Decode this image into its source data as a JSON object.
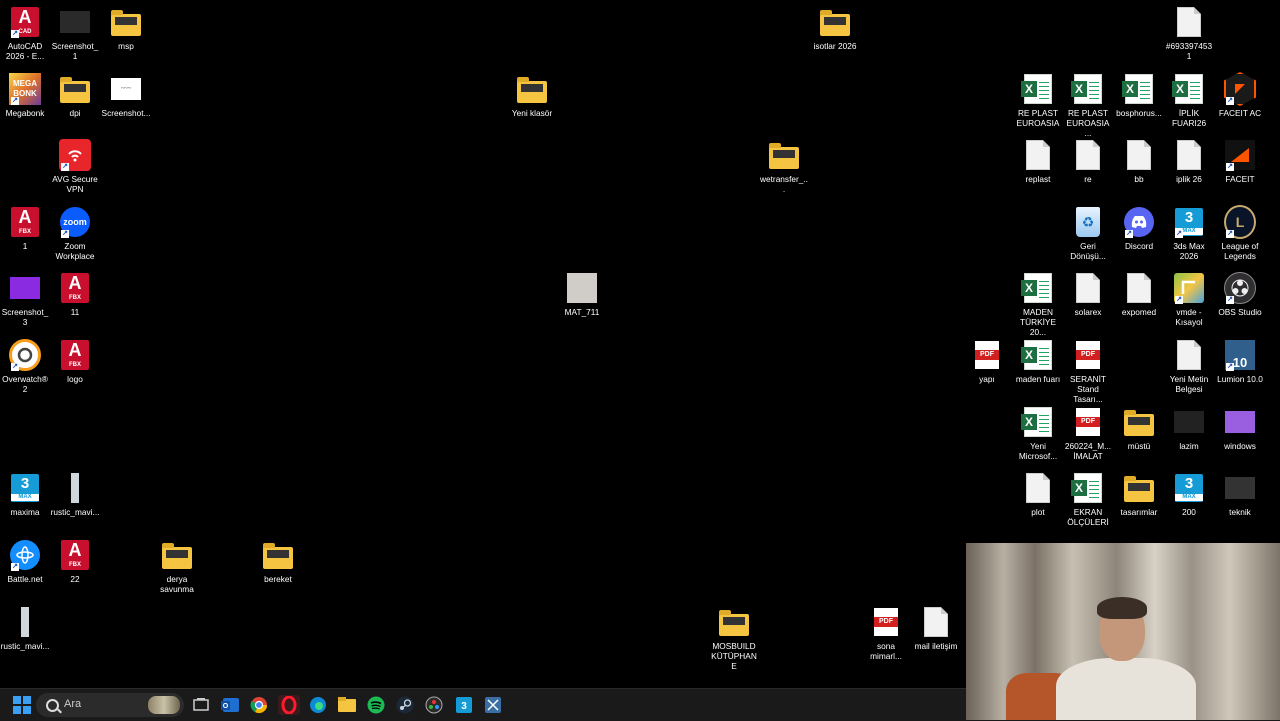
{
  "desktop": {
    "icons": [
      {
        "label": "AutoCAD 2026 - E...",
        "type": "acad",
        "sub": "CAD",
        "shortcut": true
      },
      {
        "label": "Screenshot_1",
        "type": "thumb",
        "color": "#2a2a2a"
      },
      {
        "label": "msp",
        "type": "folder"
      },
      {
        "label": "Megabonk",
        "type": "megabonk",
        "shortcut": true
      },
      {
        "label": "dpi",
        "type": "folder"
      },
      {
        "label": "Screenshot...",
        "type": "thumb-white"
      },
      {
        "label": "AVG Secure VPN",
        "type": "avg",
        "shortcut": true
      },
      {
        "label": "1",
        "type": "acad",
        "sub": "FBX"
      },
      {
        "label": "Zoom Workplace",
        "type": "zoom",
        "shortcut": true
      },
      {
        "label": "Screenshot_3",
        "type": "thumb",
        "color": "#8a2be2"
      },
      {
        "label": "11",
        "type": "acad",
        "sub": "FBX"
      },
      {
        "label": "Overwatch® 2",
        "type": "overwatch",
        "shortcut": true
      },
      {
        "label": "logo",
        "type": "acad",
        "sub": "FBX"
      },
      {
        "label": "maxima",
        "type": "max",
        "sub": "MAX"
      },
      {
        "label": "rustic_mavi...",
        "type": "thin"
      },
      {
        "label": "Battle.net",
        "type": "battlenet",
        "shortcut": true
      },
      {
        "label": "22",
        "type": "acad",
        "sub": "FBX"
      },
      {
        "label": "derya savunma",
        "type": "folder"
      },
      {
        "label": "bereket",
        "type": "folder"
      },
      {
        "label": "rustic_mavi...",
        "type": "thin"
      },
      {
        "label": "Yeni klasör",
        "type": "folder"
      },
      {
        "label": "MAT_711",
        "type": "gray"
      },
      {
        "label": "wetransfer_...",
        "type": "folder"
      },
      {
        "label": "isotlar 2026",
        "type": "folder"
      },
      {
        "label": "MOSBUILD KÜTÜPHANE",
        "type": "folder"
      },
      {
        "label": "sona mimarl...",
        "type": "pdf"
      },
      {
        "label": "mail iletişim",
        "type": "doc"
      },
      {
        "label": "#6933974531",
        "type": "doc"
      },
      {
        "label": "RE PLAST EUROASIA",
        "type": "excel"
      },
      {
        "label": "RE PLAST EUROASIA ...",
        "type": "excel"
      },
      {
        "label": "bosphorus...",
        "type": "excel"
      },
      {
        "label": "İPLİK FUARI26",
        "type": "excel"
      },
      {
        "label": "FACEIT AC",
        "type": "faceitac",
        "shortcut": true
      },
      {
        "label": "replast",
        "type": "doc"
      },
      {
        "label": "re",
        "type": "doc"
      },
      {
        "label": "bb",
        "type": "doc"
      },
      {
        "label": "iplik 26",
        "type": "doc"
      },
      {
        "label": "FACEIT",
        "type": "faceit",
        "shortcut": true
      },
      {
        "label": "Geri Dönüşü...",
        "type": "recycle"
      },
      {
        "label": "Discord",
        "type": "discord",
        "shortcut": true
      },
      {
        "label": "3ds Max 2026",
        "type": "max",
        "sub": "MAX",
        "shortcut": true
      },
      {
        "label": "League of Legends",
        "type": "lol",
        "shortcut": true
      },
      {
        "label": "MADEN TÜRKİYE 20...",
        "type": "excel"
      },
      {
        "label": "solarex",
        "type": "doc"
      },
      {
        "label": "expomed",
        "type": "doc"
      },
      {
        "label": "vmde - Kısayol",
        "type": "vmde",
        "shortcut": true
      },
      {
        "label": "OBS Studio",
        "type": "obs",
        "shortcut": true
      },
      {
        "label": "yapı",
        "type": "pdf"
      },
      {
        "label": "maden fuarı",
        "type": "excel"
      },
      {
        "label": "SERANİT Stand Tasarı...",
        "type": "pdf"
      },
      {
        "label": "Yeni Metin Belgesi",
        "type": "doc"
      },
      {
        "label": "Lumion 10.0",
        "type": "lumion",
        "shortcut": true
      },
      {
        "label": "Yeni Microsof...",
        "type": "excel"
      },
      {
        "label": "260224_M... İMALAT",
        "type": "pdf"
      },
      {
        "label": "müstü",
        "type": "folder"
      },
      {
        "label": "lazim",
        "type": "thumb",
        "color": "#222"
      },
      {
        "label": "windows",
        "type": "thumb",
        "color": "#9a5ee0"
      },
      {
        "label": "plot",
        "type": "doc"
      },
      {
        "label": "EKRAN ÖLÇÜLERİ",
        "type": "excel"
      },
      {
        "label": "tasarımlar",
        "type": "folder"
      },
      {
        "label": "200",
        "type": "max",
        "sub": "MAX"
      },
      {
        "label": "teknik",
        "type": "thumb",
        "color": "#333"
      }
    ]
  },
  "taskbar": {
    "search_placeholder": "Ara",
    "apps": [
      "start-icon",
      "task-view-icon",
      "outlook-icon",
      "chrome-icon",
      "opera-icon",
      "edge-icon",
      "file-explorer-icon",
      "spotify-icon",
      "steam-icon",
      "davinci-icon",
      "3dsmax-icon",
      "snipping-tool-icon"
    ]
  },
  "colors": {
    "desktop_bg": "#000000",
    "taskbar_bg": "#1a1a1a",
    "folder": "#f5c542",
    "excel": "#1d6f42",
    "pdf": "#d21f1f",
    "autocad": "#c8102e",
    "max": "#159bd6"
  }
}
